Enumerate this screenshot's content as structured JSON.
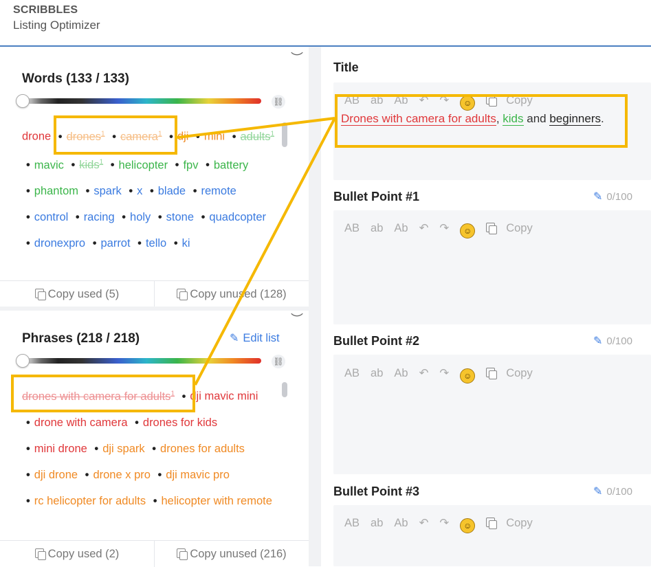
{
  "header": {
    "brand": "SCRIBBLES",
    "subtitle": "Listing Optimizer"
  },
  "words_panel": {
    "title": "Words (133 / 133)",
    "items": [
      {
        "text": "drone",
        "color": "red",
        "struck": false,
        "sup": ""
      },
      {
        "text": "drones",
        "color": "orange",
        "struck": true,
        "sup": "1"
      },
      {
        "text": "camera",
        "color": "orange",
        "struck": true,
        "sup": "1"
      },
      {
        "text": "dji",
        "color": "orange",
        "struck": false,
        "sup": ""
      },
      {
        "text": "mini",
        "color": "orange",
        "struck": false,
        "sup": ""
      },
      {
        "text": "adults",
        "color": "green",
        "struck": true,
        "sup": "1"
      },
      {
        "text": "mavic",
        "color": "green",
        "struck": false,
        "sup": ""
      },
      {
        "text": "kids",
        "color": "green",
        "struck": true,
        "sup": "1"
      },
      {
        "text": "helicopter",
        "color": "green",
        "struck": false,
        "sup": ""
      },
      {
        "text": "fpv",
        "color": "green",
        "struck": false,
        "sup": ""
      },
      {
        "text": "battery",
        "color": "green",
        "struck": false,
        "sup": ""
      },
      {
        "text": "phantom",
        "color": "green",
        "struck": false,
        "sup": ""
      },
      {
        "text": "spark",
        "color": "blue",
        "struck": false,
        "sup": ""
      },
      {
        "text": "x",
        "color": "blue",
        "struck": false,
        "sup": ""
      },
      {
        "text": "blade",
        "color": "blue",
        "struck": false,
        "sup": ""
      },
      {
        "text": "remote",
        "color": "blue",
        "struck": false,
        "sup": ""
      },
      {
        "text": "control",
        "color": "blue",
        "struck": false,
        "sup": ""
      },
      {
        "text": "racing",
        "color": "blue",
        "struck": false,
        "sup": ""
      },
      {
        "text": "holy",
        "color": "blue",
        "struck": false,
        "sup": ""
      },
      {
        "text": "stone",
        "color": "blue",
        "struck": false,
        "sup": ""
      },
      {
        "text": "quadcopter",
        "color": "blue",
        "struck": false,
        "sup": ""
      },
      {
        "text": "dronexpro",
        "color": "blue",
        "struck": false,
        "sup": ""
      },
      {
        "text": "parrot",
        "color": "blue",
        "struck": false,
        "sup": ""
      },
      {
        "text": "tello",
        "color": "blue",
        "struck": false,
        "sup": ""
      },
      {
        "text": "ki",
        "color": "blue",
        "struck": false,
        "sup": ""
      }
    ],
    "copy_used": "Copy used (5)",
    "copy_unused": "Copy unused (128)"
  },
  "phrases_panel": {
    "title": "Phrases (218 / 218)",
    "edit_list": "Edit list",
    "items": [
      {
        "text": "drones with camera for adults",
        "color": "red",
        "struck": true,
        "sup": "1"
      },
      {
        "text": "dji mavic mini",
        "color": "red",
        "struck": false,
        "sup": ""
      },
      {
        "text": "drone with camera",
        "color": "red",
        "struck": false,
        "sup": ""
      },
      {
        "text": "drones for kids",
        "color": "red",
        "struck": false,
        "sup": ""
      },
      {
        "text": "mini drone",
        "color": "red",
        "struck": false,
        "sup": ""
      },
      {
        "text": "dji spark",
        "color": "orange",
        "struck": false,
        "sup": ""
      },
      {
        "text": "drones for adults",
        "color": "orange",
        "struck": false,
        "sup": ""
      },
      {
        "text": "dji drone",
        "color": "orange",
        "struck": false,
        "sup": ""
      },
      {
        "text": "drone x pro",
        "color": "orange",
        "struck": false,
        "sup": ""
      },
      {
        "text": "dji mavic pro",
        "color": "orange",
        "struck": false,
        "sup": ""
      },
      {
        "text": "rc helicopter for adults",
        "color": "orange",
        "struck": false,
        "sup": ""
      },
      {
        "text": "helicopter with remote",
        "color": "orange",
        "struck": false,
        "sup": ""
      }
    ],
    "copy_used": "Copy used (2)",
    "copy_unused": "Copy unused (216)"
  },
  "toolbar": {
    "upper": "AB",
    "lower": "ab",
    "title_case": "Ab",
    "undo": "↶",
    "redo": "↷",
    "emoji": "☺",
    "copy": "Copy"
  },
  "fields": {
    "title": {
      "label": "Title",
      "segments": [
        {
          "text": "Drones with camera for adults",
          "style": "red"
        },
        {
          "text": ", ",
          "style": "plain"
        },
        {
          "text": "kids",
          "style": "green"
        },
        {
          "text": " and ",
          "style": "plain"
        },
        {
          "text": "beginners",
          "style": "dark"
        },
        {
          "text": ".",
          "style": "plain"
        }
      ]
    },
    "bullet1": {
      "label": "Bullet Point #1",
      "counter": "0/100"
    },
    "bullet2": {
      "label": "Bullet Point #2",
      "counter": "0/100"
    },
    "bullet3": {
      "label": "Bullet Point #3",
      "counter": "0/100"
    }
  },
  "colors": {
    "red": "#e0373a",
    "orange": "#f08a24",
    "green": "#3bb54a",
    "blue": "#3b7be0",
    "highlight": "#f5b800"
  }
}
